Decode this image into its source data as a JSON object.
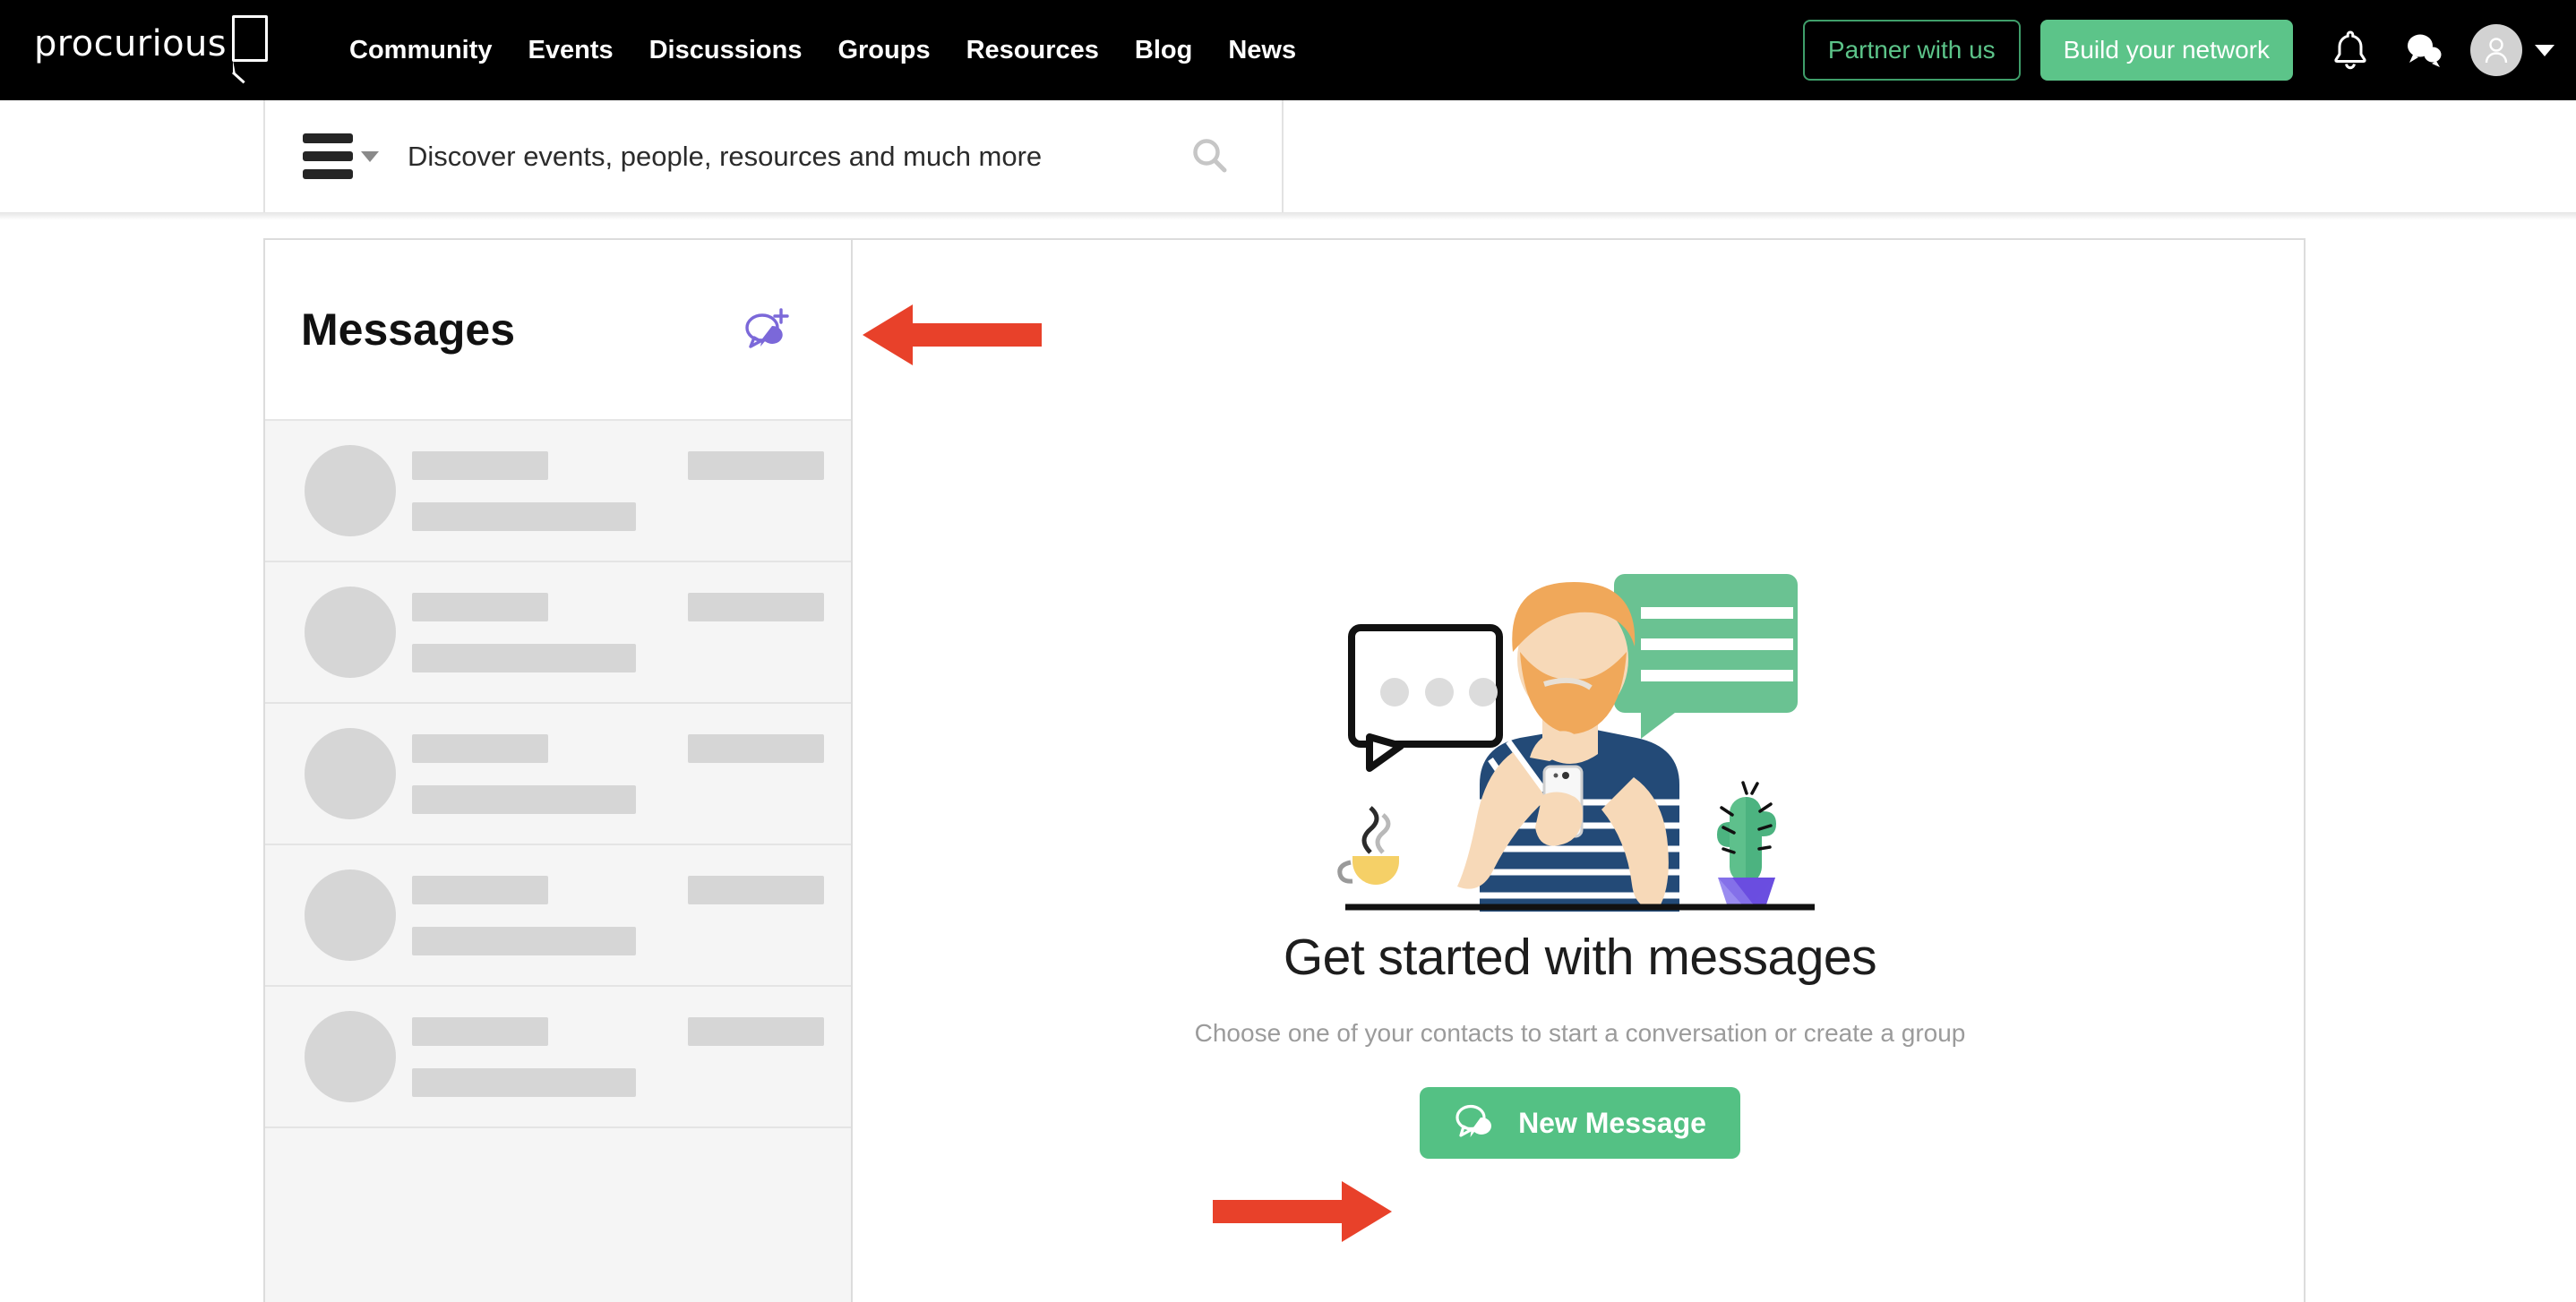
{
  "brand": {
    "name": "procurious",
    "accent_green": "#5cc489",
    "accent_purple": "#7b68d9",
    "annotation_red": "#e8412a"
  },
  "topnav": {
    "links": [
      {
        "label": "Community"
      },
      {
        "label": "Events"
      },
      {
        "label": "Discussions"
      },
      {
        "label": "Groups"
      },
      {
        "label": "Resources"
      },
      {
        "label": "Blog"
      },
      {
        "label": "News"
      }
    ],
    "partner_button": "Partner with us",
    "network_button": "Build your network",
    "icons": {
      "notifications": "bell-icon",
      "messages": "chat-bubble-icon",
      "avatar": "user-avatar",
      "account_menu": "chevron-down-icon"
    }
  },
  "search": {
    "menu_icon": "hamburger-menu-icon",
    "menu_caret": "chevron-down-icon",
    "placeholder": "Discover events, people, resources and much more",
    "value": "",
    "submit_icon": "search-icon"
  },
  "messages_panel": {
    "title": "Messages",
    "new_message_icon": "new-message-bubble-plus-icon",
    "skeleton_rows": [
      {
        "id": 1
      },
      {
        "id": 2
      },
      {
        "id": 3
      },
      {
        "id": 4
      },
      {
        "id": 5
      }
    ]
  },
  "empty_state": {
    "illustration": "person-with-phone-and-speech-bubbles-illustration",
    "title": "Get started with messages",
    "subtitle": "Choose one of your contacts to start a conversation or create a group",
    "button_label": "New Message",
    "button_icon": "chat-bubbles-icon"
  },
  "annotations": [
    {
      "name": "arrow-to-new-message-icon",
      "direction": "left"
    },
    {
      "name": "arrow-to-new-message-button",
      "direction": "right"
    }
  ]
}
